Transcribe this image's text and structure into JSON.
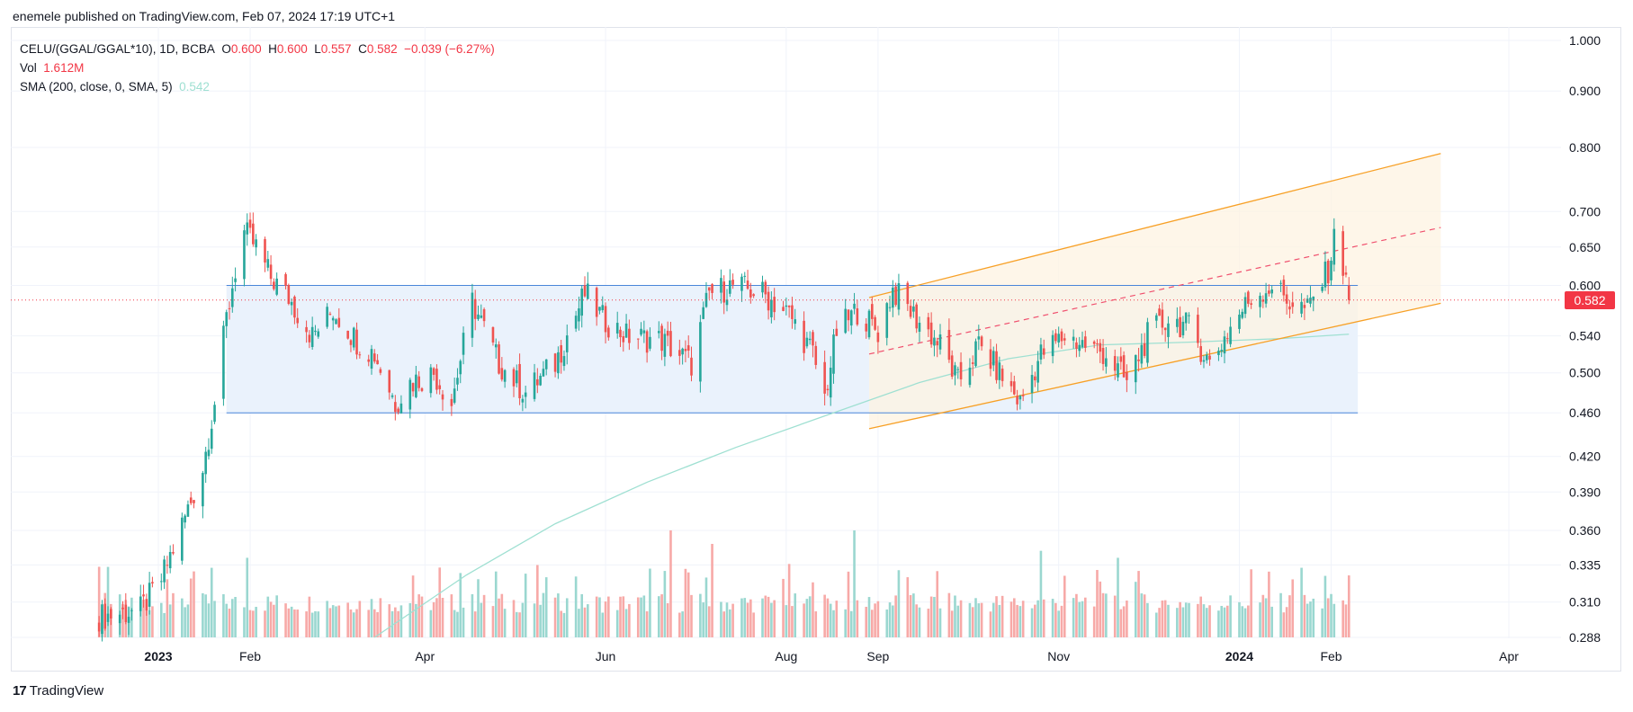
{
  "header": {
    "published": "enemele published on TradingView.com, Feb 07, 2024 17:19 UTC+1"
  },
  "legend": {
    "symbol": "CELU/(GGAL/GGAL*10), 1D, BCBA",
    "o_label": "O",
    "o_value": "0.600",
    "h_label": "H",
    "h_value": "0.600",
    "l_label": "L",
    "l_value": "0.557",
    "c_label": "C",
    "c_value": "0.582",
    "change": "−0.039 (−6.27%)",
    "vol_label": "Vol",
    "vol_value": "1.612M",
    "sma_label": "SMA (200, close, 0, SMA, 5)",
    "sma_value": "0.542"
  },
  "last_price_tag": "0.582",
  "footer": {
    "brand": "TradingView",
    "logo_glyph": "17"
  },
  "colors": {
    "up": "#26a69a",
    "down": "#ef5350",
    "vol_up": "#9ad7d0",
    "vol_down": "#f7a9a7",
    "sma": "#9fe0d2",
    "range_fill": "#eaf2fc",
    "range_line": "#4a86d9",
    "channel_line": "#f7a026",
    "channel_fill": "#fdf3e1",
    "mid_dash": "#f0506e",
    "price_line": "#f23645"
  },
  "chart_data": {
    "type": "candlestick",
    "y_scale": "log",
    "y_ticks": [
      "1.000",
      "0.900",
      "0.800",
      "0.700",
      "0.650",
      "0.600",
      "0.540",
      "0.500",
      "0.460",
      "0.420",
      "0.390",
      "0.360",
      "0.335",
      "0.310",
      "0.288"
    ],
    "x_ticks": [
      "2023",
      "Feb",
      "Apr",
      "Jun",
      "Aug",
      "Sep",
      "Nov",
      "2024",
      "Feb",
      "Apr"
    ],
    "bold_x_ticks": [
      "2023",
      "2024"
    ],
    "last_close": 0.582,
    "close_anchors": [
      [
        "2022-12-10",
        0.3
      ],
      [
        "2022-12-26",
        0.305
      ],
      [
        "2023-01-02",
        0.325
      ],
      [
        "2023-01-10",
        0.37
      ],
      [
        "2023-01-16",
        0.41
      ],
      [
        "2023-01-20",
        0.47
      ],
      [
        "2023-01-24",
        0.56
      ],
      [
        "2023-01-27",
        0.62
      ],
      [
        "2023-01-30",
        0.67
      ],
      [
        "2023-02-03",
        0.65
      ],
      [
        "2023-02-08",
        0.61
      ],
      [
        "2023-02-14",
        0.585
      ],
      [
        "2023-02-22",
        0.54
      ],
      [
        "2023-03-01",
        0.57
      ],
      [
        "2023-03-09",
        0.535
      ],
      [
        "2023-03-15",
        0.52
      ],
      [
        "2023-03-22",
        0.47
      ],
      [
        "2023-03-27",
        0.49
      ],
      [
        "2023-04-04",
        0.5
      ],
      [
        "2023-04-10",
        0.47
      ],
      [
        "2023-04-17",
        0.58
      ],
      [
        "2023-04-26",
        0.51
      ],
      [
        "2023-05-05",
        0.48
      ],
      [
        "2023-05-15",
        0.51
      ],
      [
        "2023-05-25",
        0.59
      ],
      [
        "2023-05-31",
        0.56
      ],
      [
        "2023-06-08",
        0.54
      ],
      [
        "2023-06-20",
        0.535
      ],
      [
        "2023-06-30",
        0.51
      ],
      [
        "2023-07-06",
        0.59
      ],
      [
        "2023-07-14",
        0.6
      ],
      [
        "2023-07-24",
        0.59
      ],
      [
        "2023-08-02",
        0.565
      ],
      [
        "2023-08-10",
        0.52
      ],
      [
        "2023-08-14",
        0.475
      ],
      [
        "2023-08-18",
        0.545
      ],
      [
        "2023-08-25",
        0.57
      ],
      [
        "2023-09-01",
        0.545
      ],
      [
        "2023-09-06",
        0.595
      ],
      [
        "2023-09-14",
        0.56
      ],
      [
        "2023-09-22",
        0.53
      ],
      [
        "2023-09-28",
        0.49
      ],
      [
        "2023-10-05",
        0.53
      ],
      [
        "2023-10-12",
        0.5
      ],
      [
        "2023-10-19",
        0.47
      ],
      [
        "2023-10-26",
        0.52
      ],
      [
        "2023-11-03",
        0.54
      ],
      [
        "2023-11-10",
        0.53
      ],
      [
        "2023-11-17",
        0.52
      ],
      [
        "2023-11-24",
        0.49
      ],
      [
        "2023-12-01",
        0.54
      ],
      [
        "2023-12-08",
        0.56
      ],
      [
        "2023-12-15",
        0.55
      ],
      [
        "2023-12-22",
        0.51
      ],
      [
        "2023-12-29",
        0.55
      ],
      [
        "2024-01-05",
        0.585
      ],
      [
        "2024-01-12",
        0.6
      ],
      [
        "2024-01-18",
        0.58
      ],
      [
        "2024-01-24",
        0.57
      ],
      [
        "2024-01-31",
        0.62
      ],
      [
        "2024-02-02",
        0.66
      ],
      [
        "2024-02-05",
        0.625
      ],
      [
        "2024-02-06",
        0.621
      ],
      [
        "2024-02-07",
        0.582
      ]
    ],
    "volume_spikes": [
      [
        "2023-01-31",
        0.34
      ],
      [
        "2023-06-23",
        0.36
      ],
      [
        "2023-07-07",
        0.35
      ],
      [
        "2023-08-24",
        0.36
      ],
      [
        "2023-11-21",
        0.34
      ],
      [
        "2023-11-25",
        0.39
      ],
      [
        "2023-10-26",
        0.345
      ],
      [
        "2024-01-22",
        0.333
      ]
    ],
    "sma200": [
      [
        "2023-03-15",
        0.288
      ],
      [
        "2023-04-15",
        0.328
      ],
      [
        "2023-05-15",
        0.365
      ],
      [
        "2023-06-15",
        0.398
      ],
      [
        "2023-07-15",
        0.428
      ],
      [
        "2023-08-15",
        0.458
      ],
      [
        "2023-09-15",
        0.49
      ],
      [
        "2023-10-15",
        0.515
      ],
      [
        "2023-11-15",
        0.53
      ],
      [
        "2023-12-15",
        0.533
      ],
      [
        "2024-01-15",
        0.537
      ],
      [
        "2024-02-07",
        0.542
      ]
    ],
    "range_box": {
      "start": "2023-01-24",
      "end": "2024-02-10",
      "top": 0.6,
      "bottom": 0.46
    },
    "channel": {
      "start": "2023-08-29",
      "end": "2024-03-09",
      "lower": [
        0.445,
        0.578
      ],
      "upper": [
        0.585,
        0.79
      ],
      "mid": [
        0.52,
        0.677
      ]
    }
  }
}
